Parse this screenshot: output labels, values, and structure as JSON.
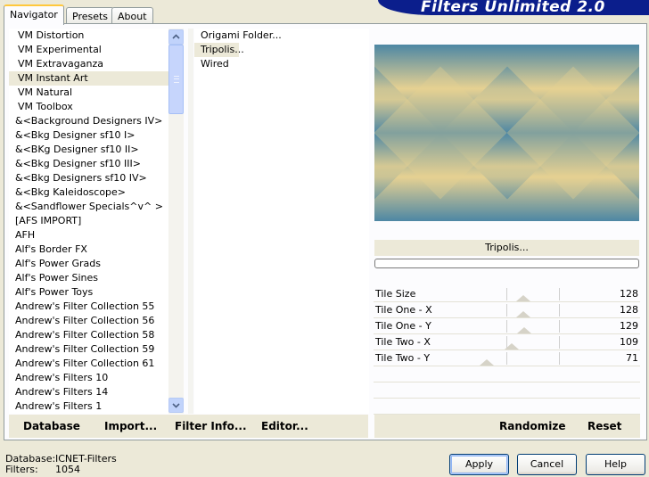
{
  "banner": {
    "title": "Filters Unlimited 2.0",
    "color": "#0b1e8c"
  },
  "tabs": [
    {
      "label": "Navigator",
      "active": true
    },
    {
      "label": "Presets",
      "active": false
    },
    {
      "label": "About",
      "active": false
    }
  ],
  "categories": {
    "selected_index": 3,
    "items": [
      "VM Distortion",
      "VM Experimental",
      "VM Extravaganza",
      "VM Instant Art",
      "VM Natural",
      "VM Toolbox",
      "&<Background Designers IV>",
      "&<Bkg Designer sf10 I>",
      "&<BKg Designer sf10 II>",
      "&<Bkg Designer sf10 III>",
      "&<Bkg Designers sf10 IV>",
      "&<Bkg Kaleidoscope>",
      "&<Sandflower Specials^v^ >",
      "[AFS IMPORT]",
      "AFH",
      "Alf's Border FX",
      "Alf's Power Grads",
      "Alf's Power Sines",
      "Alf's Power Toys",
      "Andrew's Filter Collection 55",
      "Andrew's Filter Collection 56",
      "Andrew's Filter Collection 58",
      "Andrew's Filter Collection 59",
      "Andrew's Filter Collection 61",
      "Andrew's Filters 10",
      "Andrew's Filters 14",
      "Andrew's Filters 1"
    ]
  },
  "filters": {
    "selected_index": 1,
    "items": [
      "Origami Folder...",
      "Tripolis...",
      "Wired"
    ]
  },
  "preview": {
    "color_blue": "#4d87a4",
    "color_gold": "#e6d192"
  },
  "selected_filter_label": "Tripolis...",
  "parameters": [
    {
      "label": "Tile Size",
      "value": 128,
      "max": 255
    },
    {
      "label": "Tile One - X",
      "value": 128,
      "max": 255
    },
    {
      "label": "Tile One - Y",
      "value": 129,
      "max": 255
    },
    {
      "label": "Tile Two - X",
      "value": 109,
      "max": 255
    },
    {
      "label": "Tile Two - Y",
      "value": 71,
      "max": 255
    }
  ],
  "toolbar": {
    "database": "Database",
    "import": "Import...",
    "filter_info": "Filter Info...",
    "editor": "Editor...",
    "randomize": "Randomize",
    "reset": "Reset"
  },
  "status": {
    "database_label": "Database:",
    "database_value": "ICNET-Filters",
    "filters_label": "Filters:",
    "filters_value": "1054"
  },
  "buttons": {
    "apply": "Apply",
    "cancel": "Cancel",
    "help": "Help"
  }
}
